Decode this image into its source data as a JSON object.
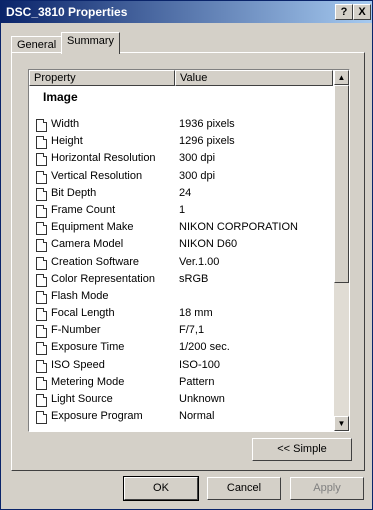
{
  "window": {
    "title": "DSC_3810 Properties",
    "help_glyph": "?",
    "close_glyph": "X"
  },
  "tabs": [
    {
      "label": "General"
    },
    {
      "label": "Summary"
    }
  ],
  "list": {
    "headers": {
      "property": "Property",
      "value": "Value"
    },
    "group": "Image",
    "rows": [
      {
        "name": "Width",
        "value": "1936 pixels"
      },
      {
        "name": "Height",
        "value": "1296 pixels"
      },
      {
        "name": "Horizontal Resolution",
        "value": "300 dpi"
      },
      {
        "name": "Vertical Resolution",
        "value": "300 dpi"
      },
      {
        "name": "Bit Depth",
        "value": "24"
      },
      {
        "name": "Frame Count",
        "value": "1"
      },
      {
        "name": "Equipment Make",
        "value": "NIKON CORPORATION"
      },
      {
        "name": "Camera Model",
        "value": "NIKON D60"
      },
      {
        "name": "Creation Software",
        "value": "Ver.1.00"
      },
      {
        "name": "Color Representation",
        "value": "sRGB"
      },
      {
        "name": "Flash Mode",
        "value": ""
      },
      {
        "name": "Focal Length",
        "value": "18 mm"
      },
      {
        "name": "F-Number",
        "value": "F/7,1"
      },
      {
        "name": "Exposure Time",
        "value": "1/200 sec."
      },
      {
        "name": "ISO Speed",
        "value": "ISO-100"
      },
      {
        "name": "Metering Mode",
        "value": "Pattern"
      },
      {
        "name": "Light Source",
        "value": "Unknown"
      },
      {
        "name": "Exposure Program",
        "value": "Normal"
      }
    ]
  },
  "buttons": {
    "simple": "<< Simple",
    "ok": "OK",
    "cancel": "Cancel",
    "apply": "Apply"
  }
}
